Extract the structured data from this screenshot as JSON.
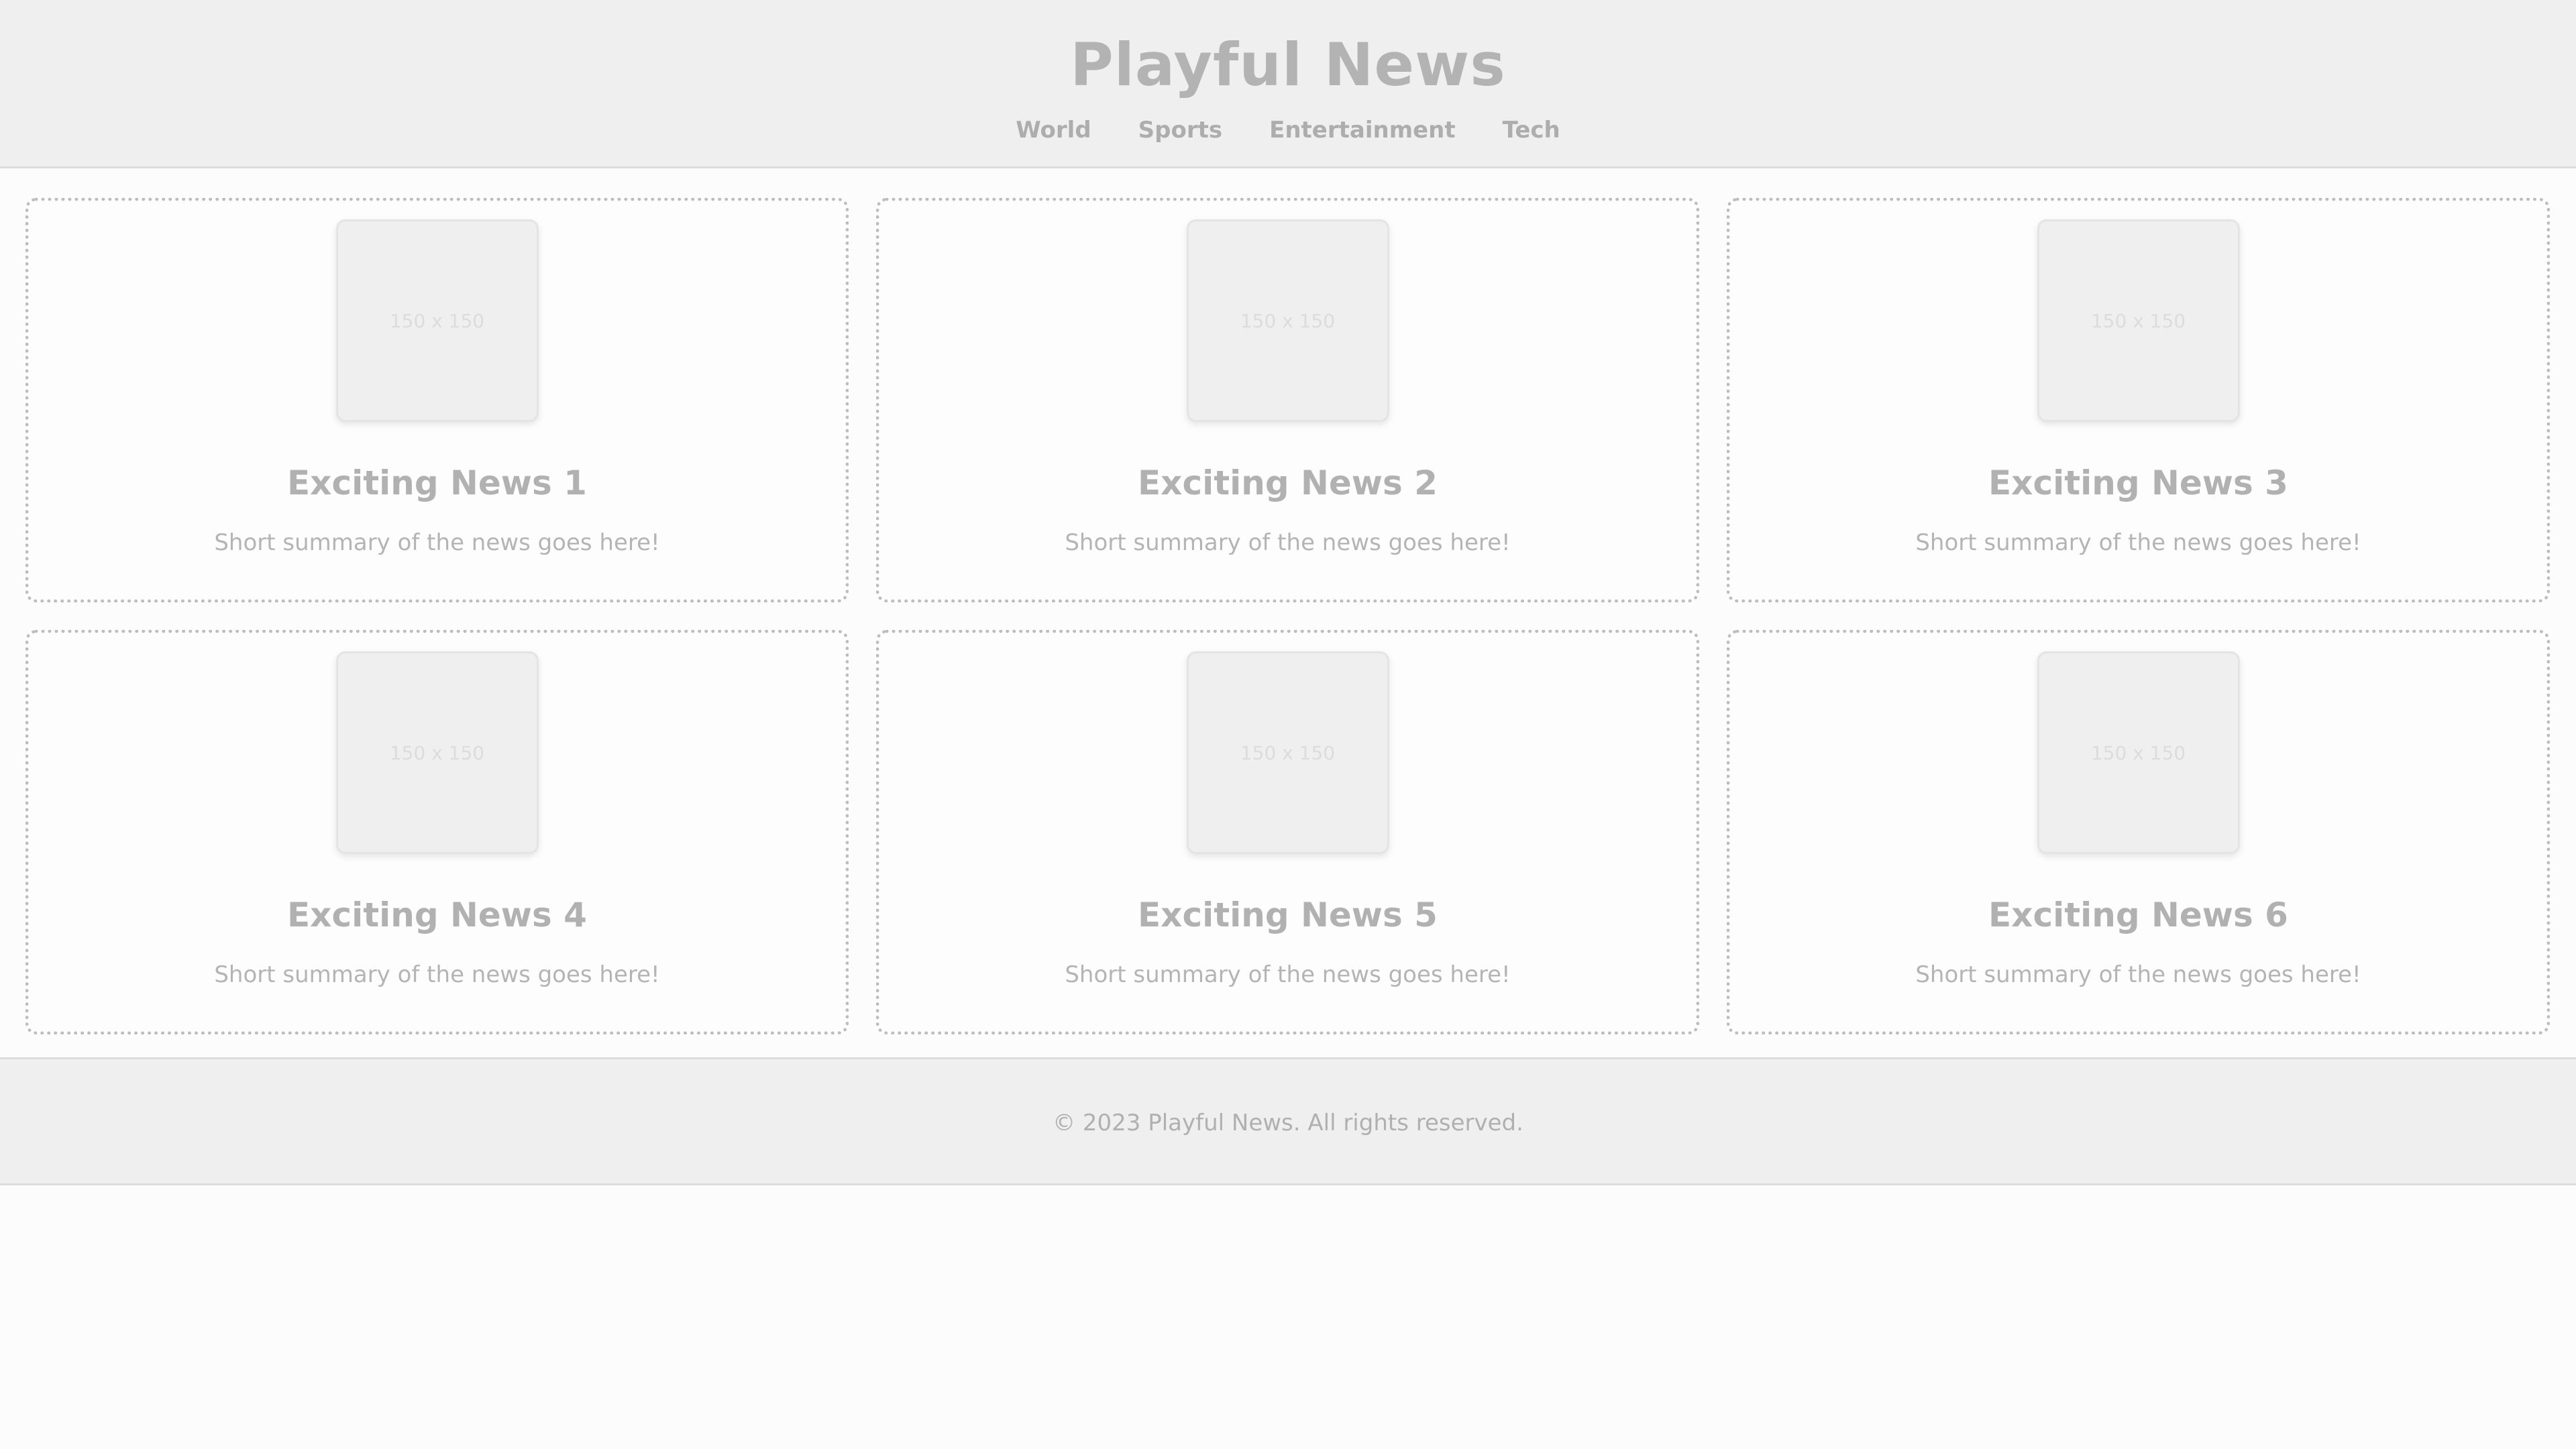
{
  "header": {
    "title": "Playful News",
    "nav": [
      "World",
      "Sports",
      "Entertainment",
      "Tech"
    ]
  },
  "articles": [
    {
      "image_label": "150 x 150",
      "title": "Exciting News 1",
      "summary": "Short summary of the news goes here!"
    },
    {
      "image_label": "150 x 150",
      "title": "Exciting News 2",
      "summary": "Short summary of the news goes here!"
    },
    {
      "image_label": "150 x 150",
      "title": "Exciting News 3",
      "summary": "Short summary of the news goes here!"
    },
    {
      "image_label": "150 x 150",
      "title": "Exciting News 4",
      "summary": "Short summary of the news goes here!"
    },
    {
      "image_label": "150 x 150",
      "title": "Exciting News 5",
      "summary": "Short summary of the news goes here!"
    },
    {
      "image_label": "150 x 150",
      "title": "Exciting News 6",
      "summary": "Short summary of the news goes here!"
    }
  ],
  "footer": {
    "text": "© 2023 Playful News. All rights reserved."
  },
  "colors": {
    "header_bg": "#efefef",
    "page_bg": "#fcfcfc",
    "text": "#b3b3b3",
    "card_border": "#bdbdbd"
  }
}
